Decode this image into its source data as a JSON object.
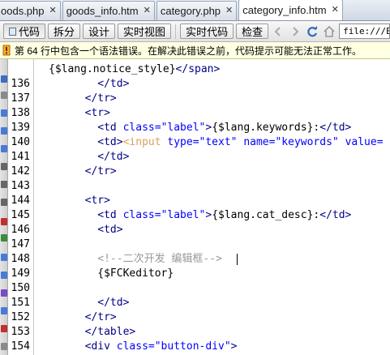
{
  "tabs": [
    {
      "label": "oods.php",
      "active": false
    },
    {
      "label": "goods_info.htm",
      "active": false
    },
    {
      "label": "category.php",
      "active": false
    },
    {
      "label": "category_info.htm",
      "active": true
    }
  ],
  "toolbar": {
    "code_label": "代码",
    "split_label": "拆分",
    "design_label": "设计",
    "live_view_label": "实时视图",
    "live_code_label": "实时代码",
    "inspect_label": "检查",
    "address_value": "file:///E:/"
  },
  "icons": {
    "back": "arrow-left-icon",
    "forward": "arrow-right-icon",
    "refresh": "refresh-icon",
    "home": "home-icon",
    "warning": "warning-icon"
  },
  "warning": {
    "text": "第 64 行中包含一个语法错误。在解决此错误之前，代码提示可能无法正常工作。"
  },
  "colors": {
    "tag": "#000088",
    "attribute": "#0000ff",
    "comment": "#999999",
    "warning_bg": "#ffffe1"
  },
  "code": {
    "top_partial": [
      {
        "t": "{$lang.notice_style}",
        "c": "plain"
      },
      {
        "t": "</span>",
        "c": "tag"
      }
    ],
    "lines": [
      {
        "n": "136",
        "indent": "      ",
        "segs": [
          {
            "t": "</td>",
            "c": "tag"
          }
        ]
      },
      {
        "n": "137",
        "indent": "    ",
        "segs": [
          {
            "t": "</tr>",
            "c": "tag"
          }
        ]
      },
      {
        "n": "138",
        "indent": "    ",
        "segs": [
          {
            "t": "<tr>",
            "c": "tag"
          }
        ]
      },
      {
        "n": "139",
        "indent": "      ",
        "segs": [
          {
            "t": "<td ",
            "c": "tag"
          },
          {
            "t": "class=",
            "c": "attr"
          },
          {
            "t": "\"label\"",
            "c": "val"
          },
          {
            "t": ">",
            "c": "tag"
          },
          {
            "t": "{$lang.keywords}:",
            "c": "plain"
          },
          {
            "t": "</td>",
            "c": "tag"
          }
        ]
      },
      {
        "n": "140",
        "indent": "      ",
        "segs": [
          {
            "t": "<td>",
            "c": "tag"
          },
          {
            "t": "<input ",
            "c": "err"
          },
          {
            "t": "type=",
            "c": "attr"
          },
          {
            "t": "\"text\" ",
            "c": "val"
          },
          {
            "t": "name=",
            "c": "attr"
          },
          {
            "t": "\"keywords\" ",
            "c": "val"
          },
          {
            "t": "value=",
            "c": "attr"
          }
        ]
      },
      {
        "n": "141",
        "indent": "      ",
        "segs": [
          {
            "t": "</td>",
            "c": "tag"
          }
        ]
      },
      {
        "n": "142",
        "indent": "    ",
        "segs": [
          {
            "t": "</tr>",
            "c": "tag"
          }
        ]
      },
      {
        "n": "143",
        "indent": "",
        "segs": []
      },
      {
        "n": "144",
        "indent": "    ",
        "segs": [
          {
            "t": "<tr>",
            "c": "tag"
          }
        ]
      },
      {
        "n": "145",
        "indent": "      ",
        "segs": [
          {
            "t": "<td ",
            "c": "tag"
          },
          {
            "t": "class=",
            "c": "attr"
          },
          {
            "t": "\"label\"",
            "c": "val"
          },
          {
            "t": ">",
            "c": "tag"
          },
          {
            "t": "{$lang.cat_desc}:",
            "c": "plain"
          },
          {
            "t": "</td>",
            "c": "tag"
          }
        ]
      },
      {
        "n": "146",
        "indent": "      ",
        "segs": [
          {
            "t": "<td>",
            "c": "tag"
          }
        ]
      },
      {
        "n": "147",
        "indent": "",
        "segs": []
      },
      {
        "n": "148",
        "indent": "      ",
        "segs": [
          {
            "t": "<!--二次开发 编辑框-->",
            "c": "com"
          }
        ],
        "caret": true
      },
      {
        "n": "149",
        "indent": "      ",
        "segs": [
          {
            "t": "{$FCKeditor}",
            "c": "plain"
          }
        ]
      },
      {
        "n": "150",
        "indent": "",
        "segs": []
      },
      {
        "n": "151",
        "indent": "      ",
        "segs": [
          {
            "t": "</td>",
            "c": "tag"
          }
        ]
      },
      {
        "n": "152",
        "indent": "    ",
        "segs": [
          {
            "t": "</tr>",
            "c": "tag"
          }
        ]
      },
      {
        "n": "153",
        "indent": "    ",
        "segs": [
          {
            "t": "</table>",
            "c": "tag"
          }
        ]
      },
      {
        "n": "154",
        "indent": "    ",
        "segs": [
          {
            "t": "<div ",
            "c": "tag"
          },
          {
            "t": "class=",
            "c": "attr"
          },
          {
            "t": "\"button-div\"",
            "c": "val"
          },
          {
            "t": ">",
            "c": "tag"
          }
        ]
      }
    ]
  }
}
